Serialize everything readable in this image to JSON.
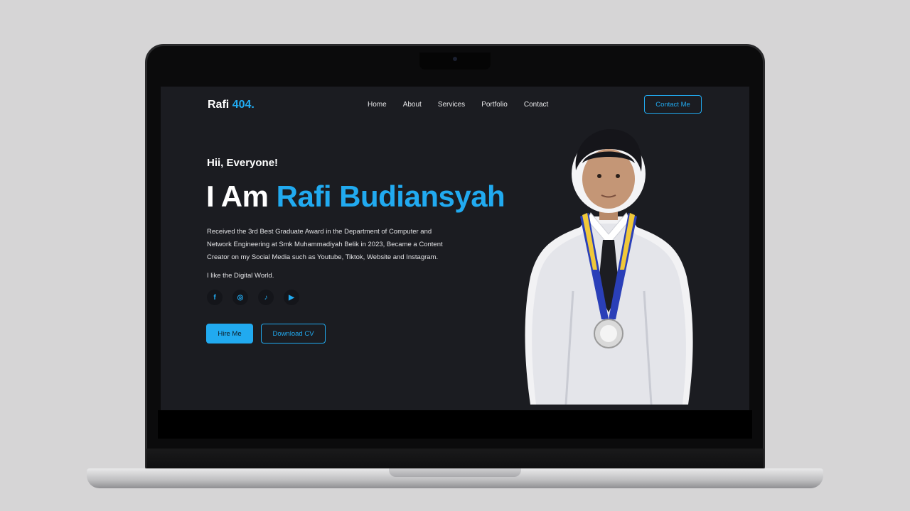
{
  "logo": {
    "name": "Rafi",
    "accent": "404."
  },
  "nav": {
    "items": [
      "Home",
      "About",
      "Services",
      "Portfolio",
      "Contact"
    ]
  },
  "header": {
    "contact_button": "Contact Me"
  },
  "hero": {
    "greeting": "Hii, Everyone!",
    "headline_prefix": "I Am",
    "headline_name": "Rafi Budiansyah",
    "description": "Received the 3rd Best Graduate Award in the Department of Computer and Network Engineering at Smk Muhammadiyah Belik in 2023, Became a Content Creator on my Social Media such as Youtube, Tiktok, Website and Instagram.",
    "tagline": "I like the Digital World.",
    "socials": [
      {
        "icon": "facebook-icon",
        "glyph": "f"
      },
      {
        "icon": "instagram-icon",
        "glyph": "◎"
      },
      {
        "icon": "tiktok-icon",
        "glyph": "♪"
      },
      {
        "icon": "youtube-icon",
        "glyph": "▶"
      }
    ],
    "hire_button": "Hire Me",
    "cv_button": "Download CV"
  },
  "colors": {
    "accent": "#21aaf0",
    "background": "#1b1c21",
    "page": "#d6d5d6"
  }
}
